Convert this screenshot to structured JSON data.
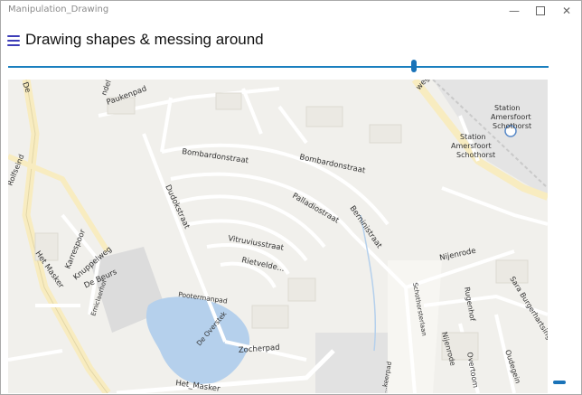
{
  "window": {
    "title": "Manipulation_Drawing",
    "minimize_icon": "minimize-icon",
    "maximize_icon": "maximize-icon",
    "close_icon": "close-icon"
  },
  "header": {
    "menu_icon": "hamburger-menu-icon",
    "title": "Drawing shapes & messing around"
  },
  "slider": {
    "value_fraction": 0.75,
    "track_color": "#1a7fbf"
  },
  "map": {
    "labels": {
      "paukenpad": "Paukenpad",
      "bombardonstraat_w": "Bombardonstraat",
      "bombardonstraat_e": "Bombardonstraat",
      "palladiostraat": "Palladiostraat",
      "berninistraat": "Berninistraat",
      "vitruviusstraat": "Vitruviusstraat",
      "rietveldestr": "Rietvelde...",
      "dudokstraat": "Dudokstraat",
      "karrespoor": "Karrespoor",
      "knuppelweg": "Knuppelweg",
      "de_beurs": "De Beurs",
      "het_masker_w": "Het Masker",
      "het_masker_s": "Het_Masker",
      "emiclaerhof": "Emiclaerhof",
      "pootermanpad": "Pootermanpad",
      "de_overstek": "De Overstek",
      "zocherpad": "Zocherpad",
      "station1": "Station",
      "station2": "Amersfoort",
      "station3": "Schothorst",
      "station_b1": "Station",
      "station_b2": "Amersfoort",
      "station_b3": "Schothorst",
      "nijenrode": "Nijenrode",
      "rugenhof": "Rugenhof",
      "nijenrode2": "Nijenrode",
      "overtoom": "Overtoom",
      "oudegein": "Oudegein",
      "sara_burgerhart": "Sara Burgerhartsingel",
      "schothorsterlaan": "Schothorsterlaan",
      "weg": "weg",
      "de_top": "De",
      "rolfseind": "Rolfseind",
      "ondel": "ndel",
      "keerpad": "...keerpad"
    }
  },
  "colors": {
    "accent": "#1a73b8",
    "hamburger": "#3d3db8",
    "water": "#b5d0ec",
    "map_bg": "#f1f0ec",
    "major_road": "#f8ecc0"
  }
}
